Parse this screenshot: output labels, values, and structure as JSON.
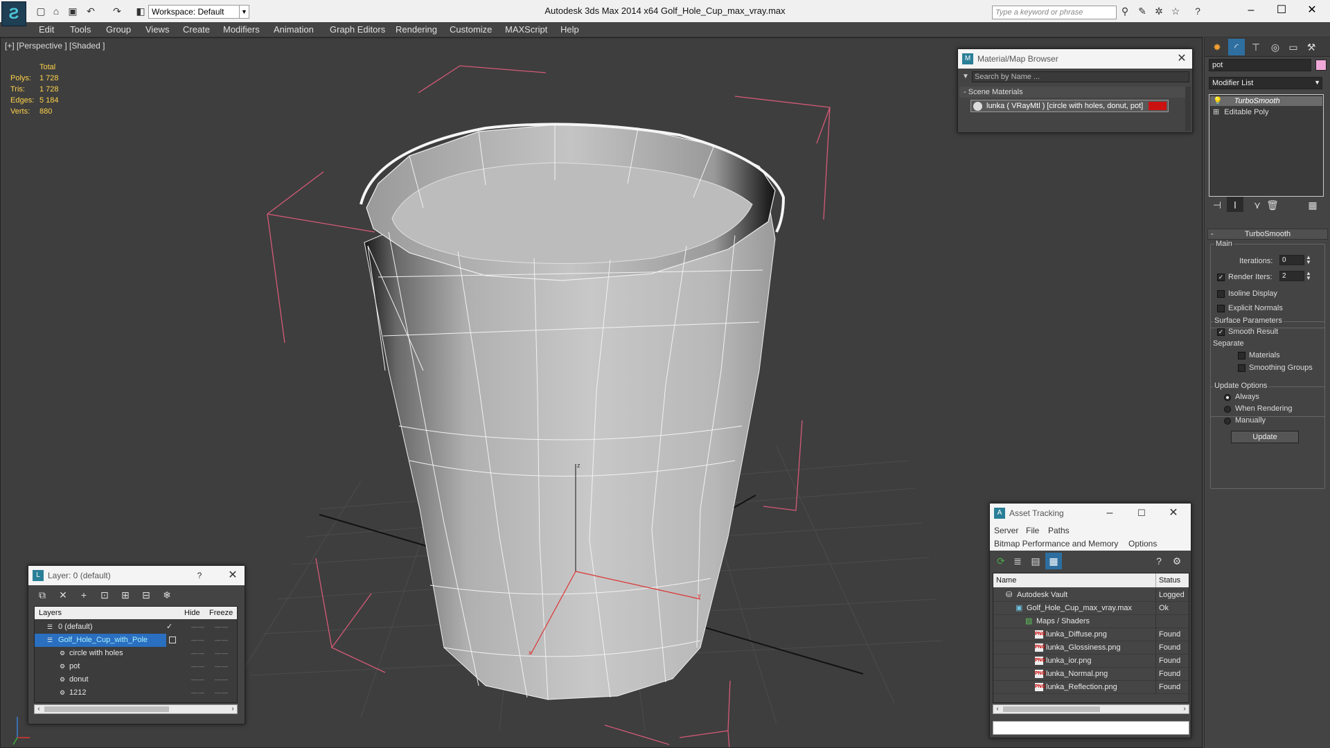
{
  "window": {
    "title": "Autodesk 3ds Max  2014 x64      Golf_Hole_Cup_max_vray.max",
    "workspace": "Workspace: Default",
    "search_placeholder": "Type a keyword or phrase"
  },
  "menu": [
    "Edit",
    "Tools",
    "Group",
    "Views",
    "Create",
    "Modifiers",
    "Animation",
    "Graph Editors",
    "Rendering",
    "Customize",
    "MAXScript",
    "Help"
  ],
  "viewport": {
    "label": "[+] [Perspective ] [Shaded ]",
    "stats": {
      "header": "Total",
      "rows": [
        {
          "k": "Polys:",
          "v": "1 728"
        },
        {
          "k": "Tris:",
          "v": "1 728"
        },
        {
          "k": "Edges:",
          "v": "5 184"
        },
        {
          "k": "Verts:",
          "v": "880"
        }
      ]
    },
    "axis_z": "z",
    "axis_y": "y",
    "axis_x": "x"
  },
  "material_browser": {
    "title": "Material/Map Browser",
    "search_placeholder": "Search by Name ...",
    "section": "Scene Materials",
    "item": "lunka  ( VRayMtl )  [circle with holes, donut, pot]",
    "item_color": "#cc1111"
  },
  "command_panel": {
    "object_name": "pot",
    "object_color": "#f0a8d8",
    "modifier_list": "Modifier List",
    "stack": [
      "TurboSmooth",
      "Editable Poly"
    ],
    "rollout": {
      "title": "TurboSmooth",
      "main_label": "Main",
      "iterations_label": "Iterations:",
      "iterations_value": "0",
      "render_iters_label": "Render Iters:",
      "render_iters_value": "2",
      "render_iters_checked": true,
      "isoline": "Isoline Display",
      "explicit_normals": "Explicit Normals",
      "surface_params": "Surface Parameters",
      "smooth_result": "Smooth Result",
      "separate": "Separate",
      "materials": "Materials",
      "smoothing_groups": "Smoothing Groups",
      "update_options": "Update Options",
      "always": "Always",
      "when_rendering": "When Rendering",
      "manually": "Manually",
      "update_button": "Update"
    }
  },
  "layer_dialog": {
    "title": "Layer: 0 (default)",
    "help": "?",
    "col_layers": "Layers",
    "col_hide": "Hide",
    "col_freeze": "Freeze",
    "rows": [
      {
        "name": "0 (default)",
        "indent": 0,
        "selected": false,
        "checked": true
      },
      {
        "name": "Golf_Hole_Cup_with_Pole",
        "indent": 0,
        "selected": true,
        "checked": false
      },
      {
        "name": "circle with holes",
        "indent": 1,
        "selected": false,
        "checked": false
      },
      {
        "name": "pot",
        "indent": 1,
        "selected": false,
        "checked": false
      },
      {
        "name": "donut",
        "indent": 1,
        "selected": false,
        "checked": false
      },
      {
        "name": "1212",
        "indent": 1,
        "selected": false,
        "checked": false
      }
    ]
  },
  "asset_tracking": {
    "title": "Asset Tracking",
    "menu1": [
      "Server",
      "File",
      "Paths"
    ],
    "menu2": [
      "Bitmap Performance and Memory",
      "Options"
    ],
    "col_name": "Name",
    "col_status": "Status",
    "rows": [
      {
        "name": "Autodesk Vault",
        "status": "Logged",
        "indent": 1,
        "kind": "vault"
      },
      {
        "name": "Golf_Hole_Cup_max_vray.max",
        "status": "Ok",
        "indent": 2,
        "kind": "max"
      },
      {
        "name": "Maps / Shaders",
        "status": "",
        "indent": 3,
        "kind": "maps"
      },
      {
        "name": "lunka_Diffuse.png",
        "status": "Found",
        "indent": 4,
        "kind": "png"
      },
      {
        "name": "lunka_Glossiness.png",
        "status": "Found",
        "indent": 4,
        "kind": "png"
      },
      {
        "name": "lunka_ior.png",
        "status": "Found",
        "indent": 4,
        "kind": "png"
      },
      {
        "name": "lunka_Normal.png",
        "status": "Found",
        "indent": 4,
        "kind": "png"
      },
      {
        "name": "lunka_Reflection.png",
        "status": "Found",
        "indent": 4,
        "kind": "png"
      }
    ]
  }
}
